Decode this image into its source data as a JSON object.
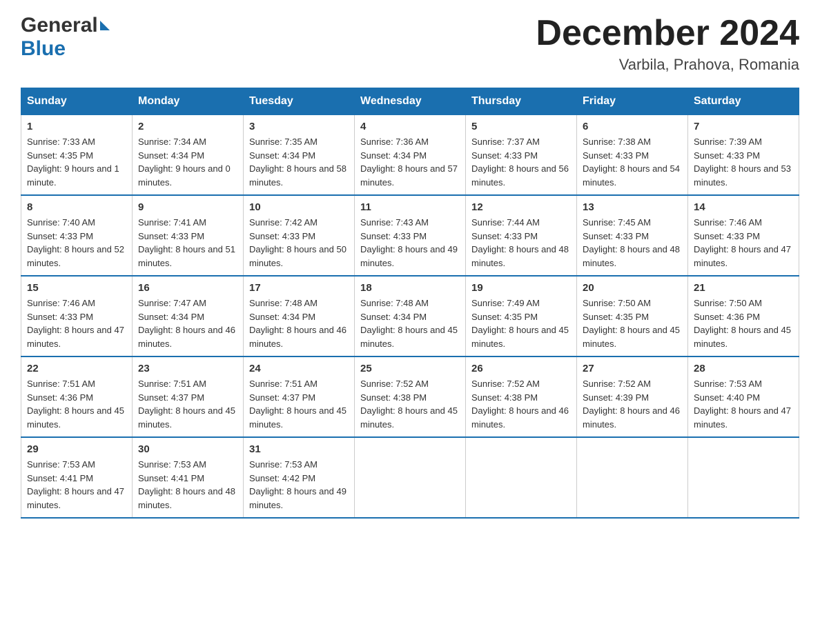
{
  "logo": {
    "line1": "General",
    "line2": "Blue"
  },
  "title": "December 2024",
  "subtitle": "Varbila, Prahova, Romania",
  "days_of_week": [
    "Sunday",
    "Monday",
    "Tuesday",
    "Wednesday",
    "Thursday",
    "Friday",
    "Saturday"
  ],
  "weeks": [
    [
      {
        "day": "1",
        "sunrise": "7:33 AM",
        "sunset": "4:35 PM",
        "daylight": "9 hours and 1 minute."
      },
      {
        "day": "2",
        "sunrise": "7:34 AM",
        "sunset": "4:34 PM",
        "daylight": "9 hours and 0 minutes."
      },
      {
        "day": "3",
        "sunrise": "7:35 AM",
        "sunset": "4:34 PM",
        "daylight": "8 hours and 58 minutes."
      },
      {
        "day": "4",
        "sunrise": "7:36 AM",
        "sunset": "4:34 PM",
        "daylight": "8 hours and 57 minutes."
      },
      {
        "day": "5",
        "sunrise": "7:37 AM",
        "sunset": "4:33 PM",
        "daylight": "8 hours and 56 minutes."
      },
      {
        "day": "6",
        "sunrise": "7:38 AM",
        "sunset": "4:33 PM",
        "daylight": "8 hours and 54 minutes."
      },
      {
        "day": "7",
        "sunrise": "7:39 AM",
        "sunset": "4:33 PM",
        "daylight": "8 hours and 53 minutes."
      }
    ],
    [
      {
        "day": "8",
        "sunrise": "7:40 AM",
        "sunset": "4:33 PM",
        "daylight": "8 hours and 52 minutes."
      },
      {
        "day": "9",
        "sunrise": "7:41 AM",
        "sunset": "4:33 PM",
        "daylight": "8 hours and 51 minutes."
      },
      {
        "day": "10",
        "sunrise": "7:42 AM",
        "sunset": "4:33 PM",
        "daylight": "8 hours and 50 minutes."
      },
      {
        "day": "11",
        "sunrise": "7:43 AM",
        "sunset": "4:33 PM",
        "daylight": "8 hours and 49 minutes."
      },
      {
        "day": "12",
        "sunrise": "7:44 AM",
        "sunset": "4:33 PM",
        "daylight": "8 hours and 48 minutes."
      },
      {
        "day": "13",
        "sunrise": "7:45 AM",
        "sunset": "4:33 PM",
        "daylight": "8 hours and 48 minutes."
      },
      {
        "day": "14",
        "sunrise": "7:46 AM",
        "sunset": "4:33 PM",
        "daylight": "8 hours and 47 minutes."
      }
    ],
    [
      {
        "day": "15",
        "sunrise": "7:46 AM",
        "sunset": "4:33 PM",
        "daylight": "8 hours and 47 minutes."
      },
      {
        "day": "16",
        "sunrise": "7:47 AM",
        "sunset": "4:34 PM",
        "daylight": "8 hours and 46 minutes."
      },
      {
        "day": "17",
        "sunrise": "7:48 AM",
        "sunset": "4:34 PM",
        "daylight": "8 hours and 46 minutes."
      },
      {
        "day": "18",
        "sunrise": "7:48 AM",
        "sunset": "4:34 PM",
        "daylight": "8 hours and 45 minutes."
      },
      {
        "day": "19",
        "sunrise": "7:49 AM",
        "sunset": "4:35 PM",
        "daylight": "8 hours and 45 minutes."
      },
      {
        "day": "20",
        "sunrise": "7:50 AM",
        "sunset": "4:35 PM",
        "daylight": "8 hours and 45 minutes."
      },
      {
        "day": "21",
        "sunrise": "7:50 AM",
        "sunset": "4:36 PM",
        "daylight": "8 hours and 45 minutes."
      }
    ],
    [
      {
        "day": "22",
        "sunrise": "7:51 AM",
        "sunset": "4:36 PM",
        "daylight": "8 hours and 45 minutes."
      },
      {
        "day": "23",
        "sunrise": "7:51 AM",
        "sunset": "4:37 PM",
        "daylight": "8 hours and 45 minutes."
      },
      {
        "day": "24",
        "sunrise": "7:51 AM",
        "sunset": "4:37 PM",
        "daylight": "8 hours and 45 minutes."
      },
      {
        "day": "25",
        "sunrise": "7:52 AM",
        "sunset": "4:38 PM",
        "daylight": "8 hours and 45 minutes."
      },
      {
        "day": "26",
        "sunrise": "7:52 AM",
        "sunset": "4:38 PM",
        "daylight": "8 hours and 46 minutes."
      },
      {
        "day": "27",
        "sunrise": "7:52 AM",
        "sunset": "4:39 PM",
        "daylight": "8 hours and 46 minutes."
      },
      {
        "day": "28",
        "sunrise": "7:53 AM",
        "sunset": "4:40 PM",
        "daylight": "8 hours and 47 minutes."
      }
    ],
    [
      {
        "day": "29",
        "sunrise": "7:53 AM",
        "sunset": "4:41 PM",
        "daylight": "8 hours and 47 minutes."
      },
      {
        "day": "30",
        "sunrise": "7:53 AM",
        "sunset": "4:41 PM",
        "daylight": "8 hours and 48 minutes."
      },
      {
        "day": "31",
        "sunrise": "7:53 AM",
        "sunset": "4:42 PM",
        "daylight": "8 hours and 49 minutes."
      },
      null,
      null,
      null,
      null
    ]
  ],
  "labels": {
    "sunrise": "Sunrise:",
    "sunset": "Sunset:",
    "daylight": "Daylight:"
  }
}
